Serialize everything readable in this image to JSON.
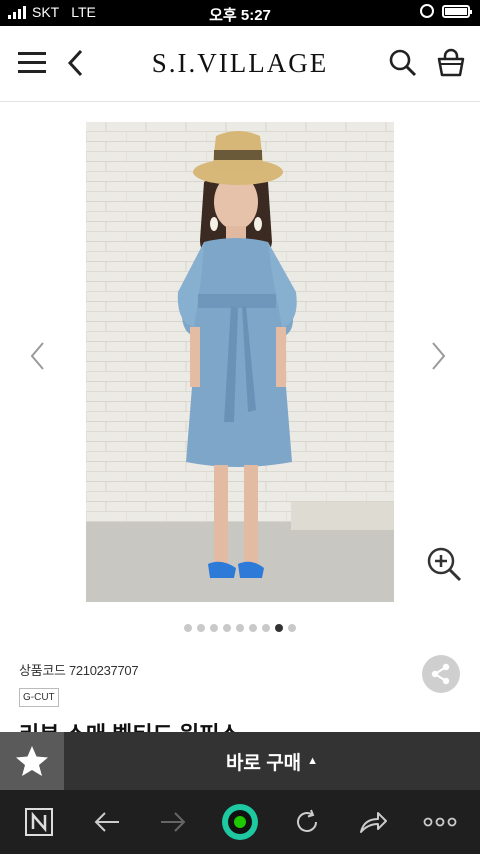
{
  "status_bar": {
    "carrier": "SKT",
    "network": "LTE",
    "time": "오후 5:27"
  },
  "header": {
    "logo": "S.I.VILLAGE",
    "icons": [
      "menu-icon",
      "back-icon",
      "search-icon",
      "shopping-bag-icon"
    ]
  },
  "gallery": {
    "dot_count": 9,
    "active_dot": 8,
    "icons": [
      "prev-arrow-icon",
      "next-arrow-icon",
      "zoom-in-icon"
    ]
  },
  "product": {
    "code_label": "상품코드 7210237707",
    "brand_tag": "G-CUT",
    "title": "리본 소매 벨티드 원피스"
  },
  "buy_bar": {
    "buy_label": "바로 구매",
    "caret": "▲",
    "accent_color": "#333333"
  },
  "browser_bar": {
    "icons": [
      "naver-home-icon",
      "back-arrow-icon",
      "forward-arrow-icon",
      "green-dot-icon",
      "refresh-icon",
      "share-arrow-icon",
      "more-icon"
    ],
    "accent_color": "#1ec800"
  }
}
